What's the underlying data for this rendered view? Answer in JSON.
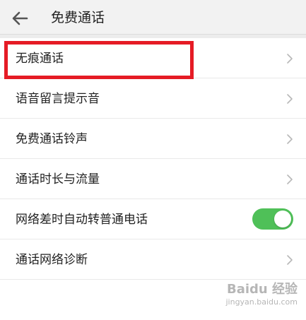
{
  "header": {
    "title": "免费通话",
    "back_icon": "arrow-left-icon",
    "background": "#f2f2f2"
  },
  "settings": {
    "items": [
      {
        "label": "无痕通话",
        "control": "chevron",
        "highlighted": true
      },
      {
        "label": "语音留言提示音",
        "control": "chevron"
      },
      {
        "label": "免费通话铃声",
        "control": "chevron"
      },
      {
        "label": "通话时长与流量",
        "control": "chevron"
      },
      {
        "label": "网络差时自动转普通电话",
        "control": "toggle",
        "toggle_on": true
      },
      {
        "label": "通话网络诊断",
        "control": "chevron"
      }
    ]
  },
  "colors": {
    "toggle_on": "#4fc058",
    "highlight": "#e51b25",
    "chevron": "#b8b8b8"
  },
  "watermark": {
    "brand": "Baidu 经验",
    "url": "jingyan.baidu.com"
  }
}
